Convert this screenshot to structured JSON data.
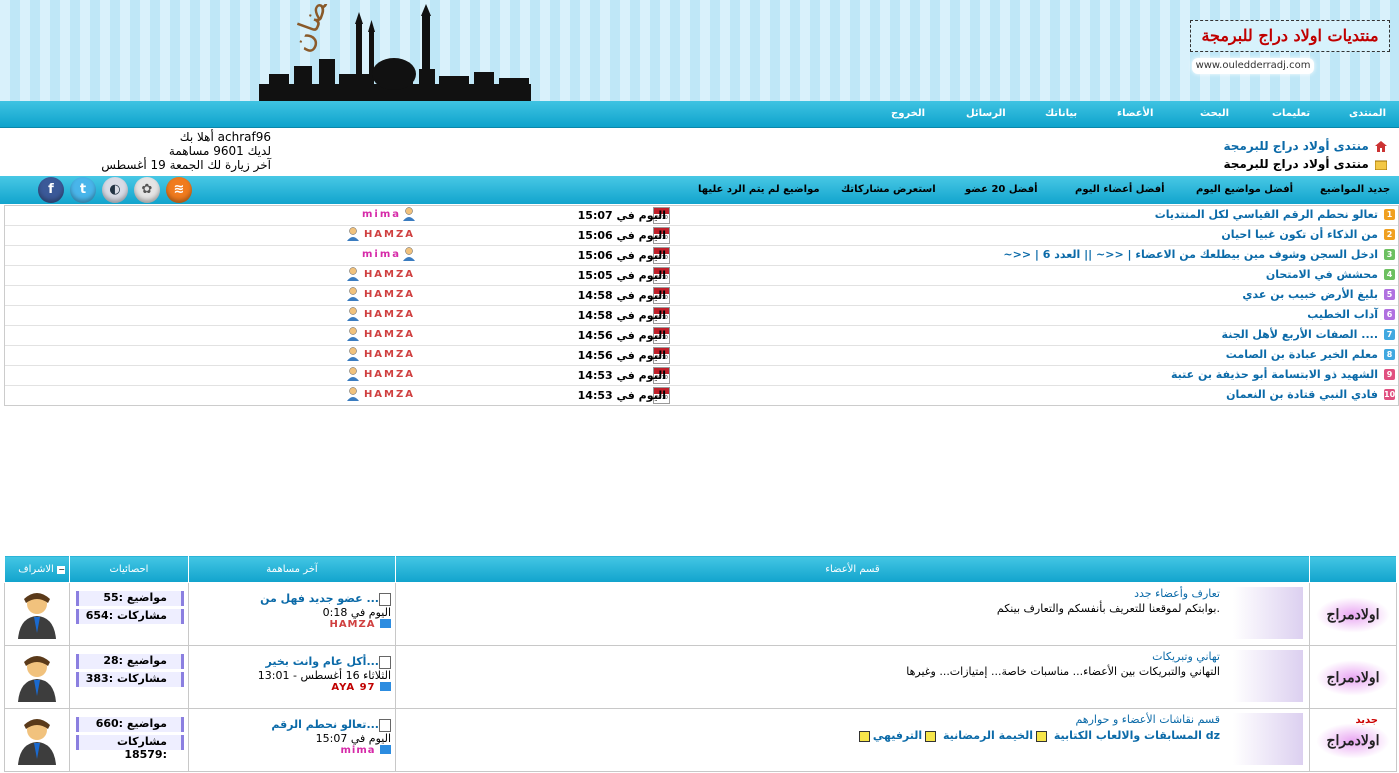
{
  "header": {
    "site_name": "منتديات اولاد دراج للبرمجة",
    "site_url": "www.ouledderradj.com"
  },
  "nav": {
    "items": [
      "المنتدى",
      "تعليمات",
      "البحث",
      "الأعضاء",
      "بياناتك",
      "الرسائل",
      "الخروج"
    ]
  },
  "breadcrumb": {
    "line1": "منتدى أولاد دراج للبرمجة",
    "line2": "منتدى أولاد دراج للبرمجة"
  },
  "user": {
    "greeting": "أهلا بك achraf96",
    "posts": "لديك 9601 مساهمة",
    "last_visit": "آخر زيارة لك الجمعة 19 أغسطس"
  },
  "toolbar": {
    "items": [
      "جديد المواضيع",
      "أفضل مواضيع اليوم",
      "أفضل أعضاء اليوم",
      "أفضل 20 عضو",
      "استعرض مشاركاتك",
      "مواضيع لم يتم الرد عليها"
    ]
  },
  "social": {
    "facebook": "f",
    "twitter": "t"
  },
  "recent": [
    {
      "num": "1",
      "color": "#f0a020",
      "title": "تعالو نحطم الرقم القياسي لكل المنتديات",
      "time": "اليوم في 15:07",
      "user": "mima",
      "ucolor": "#d62aa8"
    },
    {
      "num": "2",
      "color": "#f0a020",
      "title": "من الذكاء أن تكون غبيا احيان",
      "time": "اليوم في 15:06",
      "user": "HAMZA",
      "ucolor": "#d04040"
    },
    {
      "num": "3",
      "color": "#6cc060",
      "title": "~>> | ادخل السجن وشوف مين بيطلعك من الاعضاء | <<~ || العدد 6",
      "time": "اليوم في 15:06",
      "user": "mima",
      "ucolor": "#d62aa8"
    },
    {
      "num": "4",
      "color": "#6cc060",
      "title": "محشش في الامتحان",
      "time": "اليوم في 15:05",
      "user": "HAMZA",
      "ucolor": "#d04040"
    },
    {
      "num": "5",
      "color": "#b070e0",
      "title": "بليغ الأرض خبيب بن عدي",
      "time": "اليوم في 14:58",
      "user": "HAMZA",
      "ucolor": "#d04040"
    },
    {
      "num": "6",
      "color": "#b070e0",
      "title": "آداب الخطيب",
      "time": "اليوم في 14:58",
      "user": "HAMZA",
      "ucolor": "#d04040"
    },
    {
      "num": "7",
      "color": "#40a8e0",
      "title": "الصفات الأربع لأهل الجنة ....",
      "time": "اليوم في 14:56",
      "user": "HAMZA",
      "ucolor": "#d04040"
    },
    {
      "num": "8",
      "color": "#40a8e0",
      "title": "معلم الخير عبادة بن الصامت",
      "time": "اليوم في 14:56",
      "user": "HAMZA",
      "ucolor": "#d04040"
    },
    {
      "num": "9",
      "color": "#e05080",
      "title": "الشهيد ذو الابتسامة أبو حذيفة بن عتبة",
      "time": "اليوم في 14:53",
      "user": "HAMZA",
      "ucolor": "#d04040"
    },
    {
      "num": "10",
      "color": "#e05080",
      "title": "فادي النبي قتادة بن النعمان",
      "time": "اليوم في 14:53",
      "user": "HAMZA",
      "ucolor": "#d04040"
    }
  ],
  "forum": {
    "headers": {
      "section": "قسم الأعضاء",
      "last_post": "آخر مساهمة",
      "stats": "احصائيات",
      "moderation": "الاشراف"
    },
    "logo_text": "اولادمراج",
    "rows": [
      {
        "title": "تعارف وأعضاء جدد",
        "desc": "بوابتكم لموقعنا للتعريف بأنفسكم والتعارف بينكم.",
        "lp_title": "عضو جديد فهل من ...",
        "lp_time": "اليوم في 0:18",
        "lp_user": "HAMZA",
        "lp_ucolor": "#d04040",
        "topics": "مواضيع :55",
        "posts": "مشاركات :654"
      },
      {
        "title": "تهاني وتبريكات",
        "desc": "التهاني والتبريكات بين الأعضاء... مناسبات خاصة... إمتيازات... وغيرها",
        "lp_title": "أكل عام وانت بخير...",
        "lp_time": "الثلاثاء 16 أغسطس - 13:01",
        "lp_user": "AYA 97",
        "lp_ucolor": "#c00000",
        "topics": "مواضيع :28",
        "posts": "مشاركات :383"
      },
      {
        "title": "قسم نقاشات الأعضاء و حوارهم",
        "subs": [
          "المسابقات والالعاب الكتابية",
          "الخيمة الرمضانية",
          "الترفيهي dz"
        ],
        "lp_title": "تعالو نحطم الرقم...",
        "lp_time": "اليوم في 15:07",
        "lp_user": "mima",
        "lp_ucolor": "#d62aa8",
        "topics": "مواضيع :660",
        "posts": "مشاركات :18579",
        "badge": "جديد"
      }
    ]
  }
}
